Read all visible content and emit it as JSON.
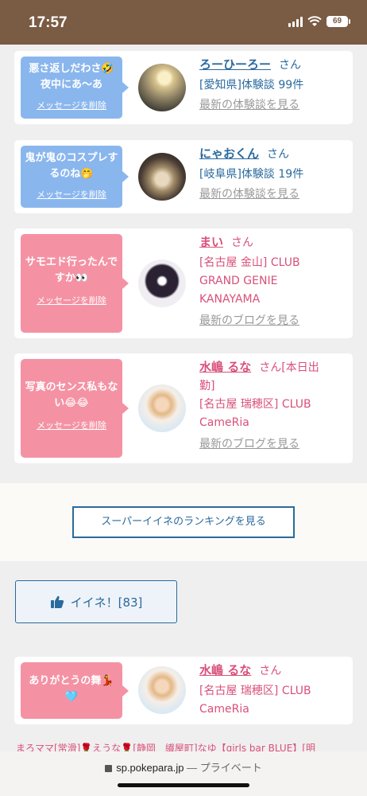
{
  "status": {
    "time": "17:57",
    "battery": "69"
  },
  "cards": [
    {
      "message": "悪さ返しだわさ🤣夜中にあ〜あ",
      "delete_label": "メッセージを削除",
      "name": "ろーひーろー",
      "suffix": "さん",
      "line1": "[愛知県]体験談 99件",
      "line2": "",
      "line3": "",
      "link": "最新の体験談を見る"
    },
    {
      "message": "鬼が鬼のコスプレするのね🤭",
      "delete_label": "メッセージを削除",
      "name": "にゃおくん",
      "suffix": "さん",
      "line1": "[岐阜県]体験談 19件",
      "line2": "",
      "line3": "",
      "link": "最新の体験談を見る"
    },
    {
      "message": "サモエド行ったんですか👀",
      "delete_label": "メッセージを削除",
      "name": "まい",
      "suffix": "さん",
      "line1": "[名古屋 金山] CLUB",
      "line2": "GRAND GENIE",
      "line3": "KANAYAMA",
      "link": "最新のブログを見る"
    },
    {
      "message": "写真のセンス私もない😂😂",
      "delete_label": "メッセージを削除",
      "name": "水嶋 るな",
      "suffix": "さん[本日出",
      "line1": "勤]",
      "line2": "[名古屋 瑞穂区] CLUB",
      "line3": "CameRia",
      "link": "最新のブログを見る"
    },
    {
      "message": "ありがとうの舞💃🩵",
      "name": "水嶋 るな",
      "suffix": "さん",
      "line1": "[名古屋 瑞穂区] CLUB",
      "line2": "CameRia"
    }
  ],
  "ranking_button": "スーパーイイネのランキングを見る",
  "iine": {
    "label": "イイネ！[83]",
    "icon": "thumbs-up-icon"
  },
  "ticker": "まろママ[常滑]🌹えうな🌹[静岡　繊屋町]なゆ【girls bar BLUE】[明",
  "urlbar": {
    "domain": "sp.pokepara.jp",
    "separator": "—",
    "private": "プライベート"
  },
  "colors": {
    "blue_bubble": "#8ab6ee",
    "pink_bubble": "#f492a4",
    "link_blue": "#2a6a9e",
    "link_pink": "#d9507a",
    "status_bar": "#7a5b43"
  }
}
